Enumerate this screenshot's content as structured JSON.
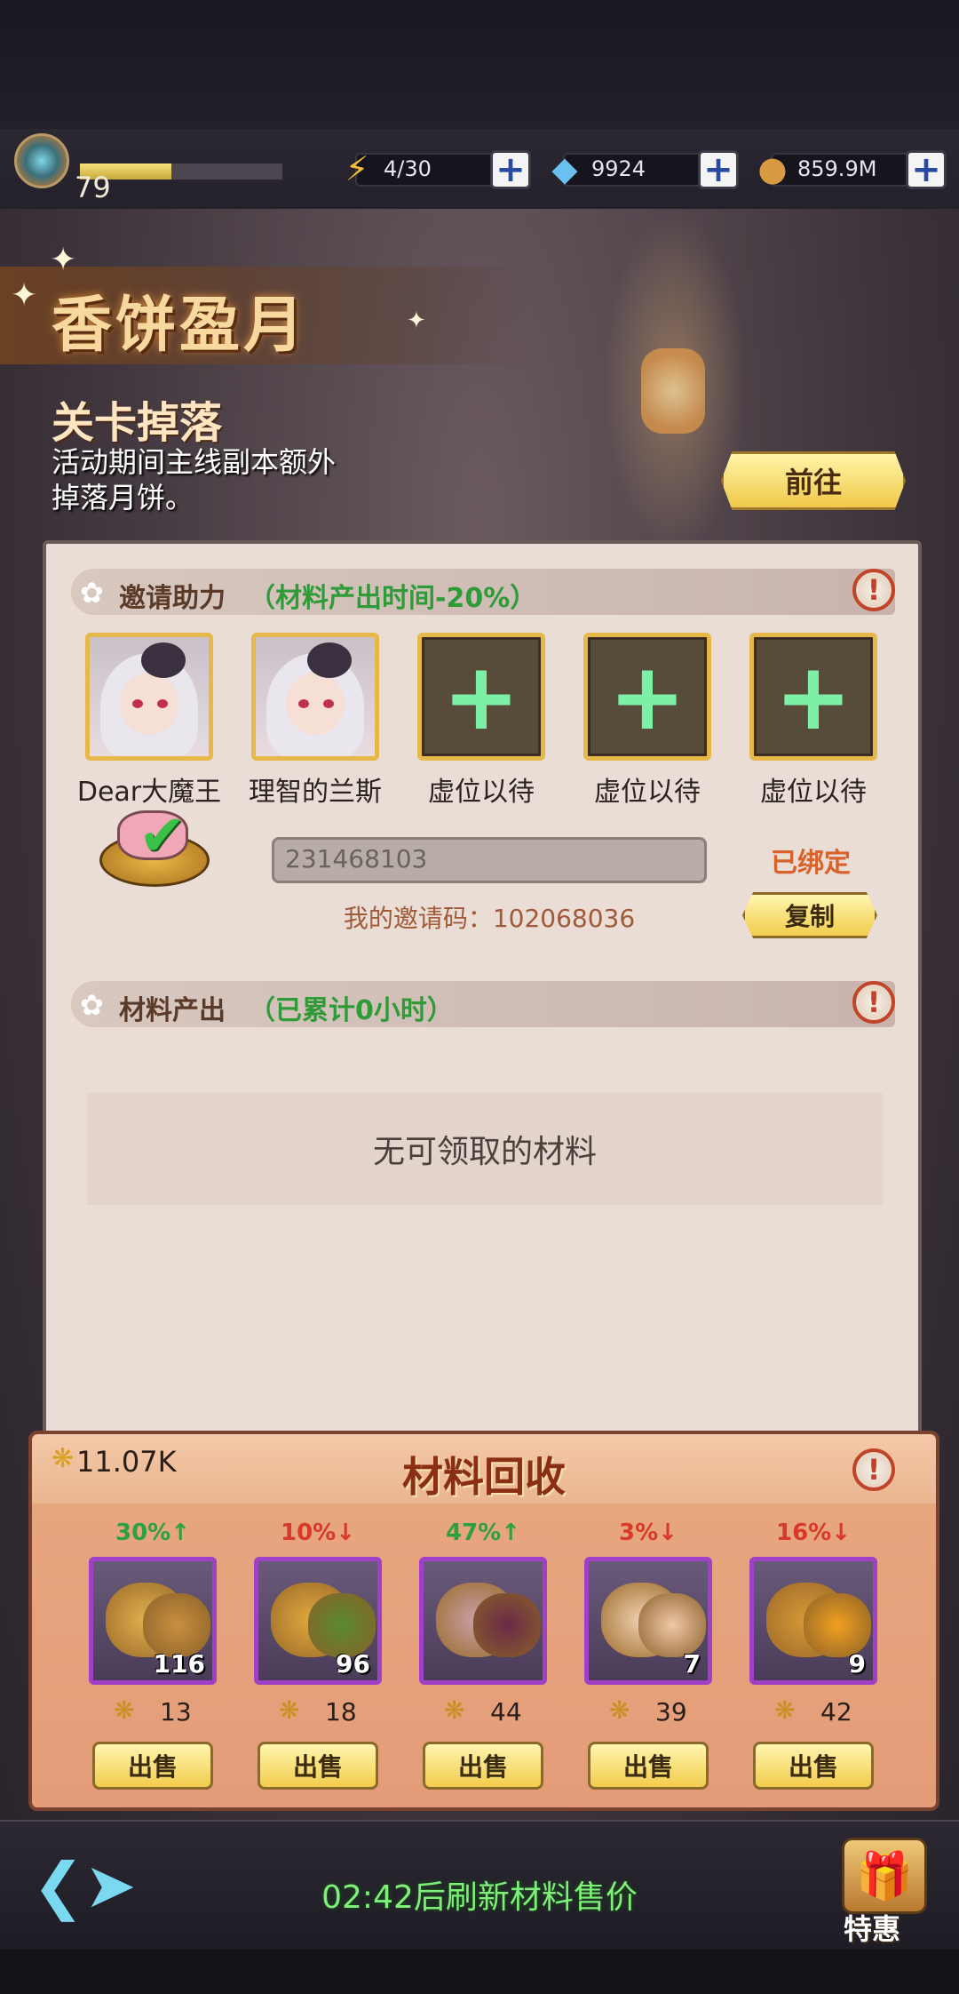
{
  "resources": {
    "level": "79",
    "xp_fraction": 0.45,
    "stamina": "4/30",
    "gems": "9924",
    "gold": "859.9M",
    "stamina_icon": "lightning-icon",
    "gem_icon": "diamond-icon",
    "gold_icon": "coin-icon"
  },
  "event": {
    "title": "香饼盈月",
    "drop_title": "关卡掉落",
    "drop_desc": "活动期间主线副本额外掉落月饼。",
    "go_label": "前往"
  },
  "invite": {
    "header": "邀请助力",
    "header_note": "（材料产出时间-20%）",
    "slots": [
      {
        "label": "Dear大魔王",
        "filled": true
      },
      {
        "label": "理智的兰斯",
        "filled": true
      },
      {
        "label": "虚位以待",
        "filled": false
      },
      {
        "label": "虚位以待",
        "filled": false
      },
      {
        "label": "虚位以待",
        "filled": false
      }
    ],
    "input_value": "231468103",
    "my_code": "我的邀请码：102068036",
    "bound_label": "已绑定",
    "copy_label": "复制"
  },
  "output": {
    "header": "材料产出",
    "header_note": "（已累计0小时）",
    "empty_text": "无可领取的材料"
  },
  "recycle": {
    "title": "材料回收",
    "total": "11.07K",
    "sell_label": "出售",
    "items": [
      {
        "pct": "30%↑",
        "trend": "up",
        "qty": "116",
        "price": "13",
        "colors": [
          "#e0b050",
          "#c89040"
        ]
      },
      {
        "pct": "10%↓",
        "trend": "down",
        "qty": "96",
        "price": "18",
        "colors": [
          "#e0a840",
          "#5a8a30"
        ]
      },
      {
        "pct": "47%↑",
        "trend": "up",
        "qty": "",
        "price": "44",
        "colors": [
          "#c8a0a8",
          "#6a2a48"
        ]
      },
      {
        "pct": "3%↓",
        "trend": "down",
        "qty": "7",
        "price": "39",
        "colors": [
          "#f0d0b0",
          "#f0c8a8"
        ]
      },
      {
        "pct": "16%↓",
        "trend": "down",
        "qty": "9",
        "price": "42",
        "colors": [
          "#d89838",
          "#f0a020"
        ]
      }
    ]
  },
  "footer": {
    "refresh_text": "02:42后刷新材料售价",
    "gift_label": "特惠"
  }
}
